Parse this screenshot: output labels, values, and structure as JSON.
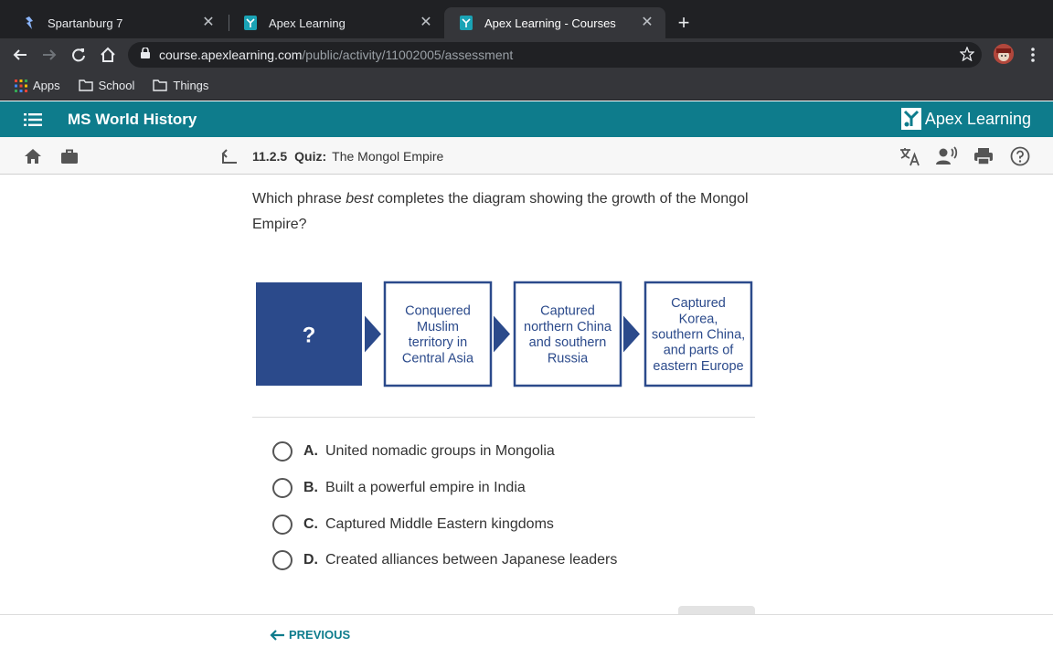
{
  "browser": {
    "tabs": [
      {
        "title": "Spartanburg 7",
        "active": false
      },
      {
        "title": "Apex Learning",
        "active": false
      },
      {
        "title": "Apex Learning - Courses",
        "active": true
      }
    ],
    "url_domain": "course.apexlearning.com",
    "url_path": "/public/activity/11002005/assessment",
    "bookmarks": [
      "Apps",
      "School",
      "Things"
    ]
  },
  "header": {
    "course_title": "MS World History",
    "brand": "Apex Learning",
    "brand_color": "#0e7c8c"
  },
  "subnav": {
    "number": "11.2.5",
    "kind": "Quiz:",
    "title": "The Mongol Empire"
  },
  "question": {
    "before": "Which phrase ",
    "emphasis": "best",
    "after": " completes the diagram showing the growth of the Mongol Empire?"
  },
  "diagram": {
    "placeholder": "?",
    "boxes": [
      [
        "Conquered",
        "Muslim",
        "territory in",
        "Central Asia"
      ],
      [
        "Captured",
        "northern China",
        "and southern",
        "Russia"
      ],
      [
        "Captured",
        "Korea,",
        "southern China,",
        "and parts of",
        "eastern Europe"
      ]
    ],
    "color": "#2b4a8b"
  },
  "options": [
    {
      "letter": "A.",
      "text": "United nomadic groups in Mongolia"
    },
    {
      "letter": "B.",
      "text": "Built a powerful empire in India"
    },
    {
      "letter": "C.",
      "text": "Captured Middle Eastern kingdoms"
    },
    {
      "letter": "D.",
      "text": "Created alliances between Japanese leaders"
    }
  ],
  "footer": {
    "previous_label": "PREVIOUS"
  }
}
